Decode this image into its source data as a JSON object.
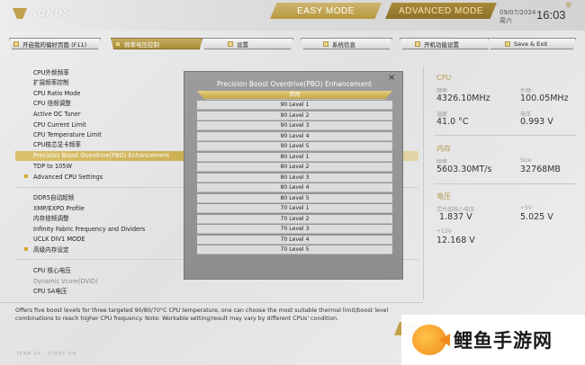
{
  "header": {
    "logo": "AORUS",
    "easy_mode": "EASY MODE",
    "advanced_mode": "ADVANCED MODE",
    "date": "09/07/2024",
    "weekday": "周六",
    "time": "16:03",
    "settings_icon": "gear-icon"
  },
  "tabs": [
    {
      "label": "开启我的偏好页面 (F11)",
      "icon": "star-icon"
    },
    {
      "label": "频率电压控制",
      "icon": "gauge-icon"
    },
    {
      "label": "设置",
      "icon": "wrench-icon"
    },
    {
      "label": "系统信息",
      "icon": "info-icon"
    },
    {
      "label": "开机功能设置",
      "icon": "power-icon"
    },
    {
      "label": "Save & Exit",
      "icon": "exit-icon"
    }
  ],
  "menu": [
    "CPU外频频率",
    "扩展频率控制",
    "CPU Ratio Mode",
    "CPU 倍频调整",
    "Active OC Tuner",
    "CPU Current Limit",
    "CPU Temperature Limit",
    "CPU核芯显卡频率",
    "Precision Boost Overdrive(PBO) Enhancement",
    "TDP to 105W",
    "Advanced CPU Settings",
    "DDR5自动超频",
    "XMP/EXPO Profile",
    "内存倍频调整",
    "Infinity Fabric Frequency and Dividers",
    "UCLK DIV1 MODE",
    "高级内存设定",
    "CPU 核心电压",
    "Dynamic Vcore(DVID)",
    "CPU SA电压"
  ],
  "sidebar": {
    "cpu": {
      "title": "CPU",
      "freq_label": "频率",
      "freq_value": "4326.10MHz",
      "bclk_label": "外频",
      "bclk_value": "100.05MHz",
      "temp_label": "温度",
      "temp_value": "41.0 °C",
      "volt_label": "电压",
      "volt_value": "0.993 V"
    },
    "memory": {
      "title": "内存",
      "freq_label": "频率",
      "freq_value": "5603.30MT/s",
      "size_label": "Size",
      "size_value": "32768MB"
    },
    "voltage": {
      "title": "电压",
      "chipset_label": "芯片组核心电压",
      "chipset_value": "1.837 V",
      "v5_label": "+5V",
      "v5_value": "5.025 V",
      "v12_label": "+12V",
      "v12_value": "12.168 V"
    }
  },
  "help_text": "Offers five boost levels for three targeted 90/80/70°C CPU temperature, one can choose the most suitable thermal limit/boost level combinations to reach higher CPU frequency. Note: Workable setting/result may vary by different CPUs' condition.",
  "footer": "TEAM UP · FIGHT ON",
  "modal": {
    "title": "Precision Boost Overdrive(PBO) Enhancement",
    "close_icon": "close-icon",
    "options": [
      "禁用",
      "90 Level 1",
      "90 Level 2",
      "90 Level 3",
      "90 Level 4",
      "90 Level 5",
      "80 Level 1",
      "80 Level 2",
      "80 Level 3",
      "80 Level 4",
      "80 Level 5",
      "70 Level 1",
      "70 Level 2",
      "70 Level 3",
      "70 Level 4",
      "70 Level 5"
    ],
    "selected_index": 0
  },
  "watermark": {
    "text": "鲤鱼手游网",
    "icon": "fish-logo-icon"
  }
}
